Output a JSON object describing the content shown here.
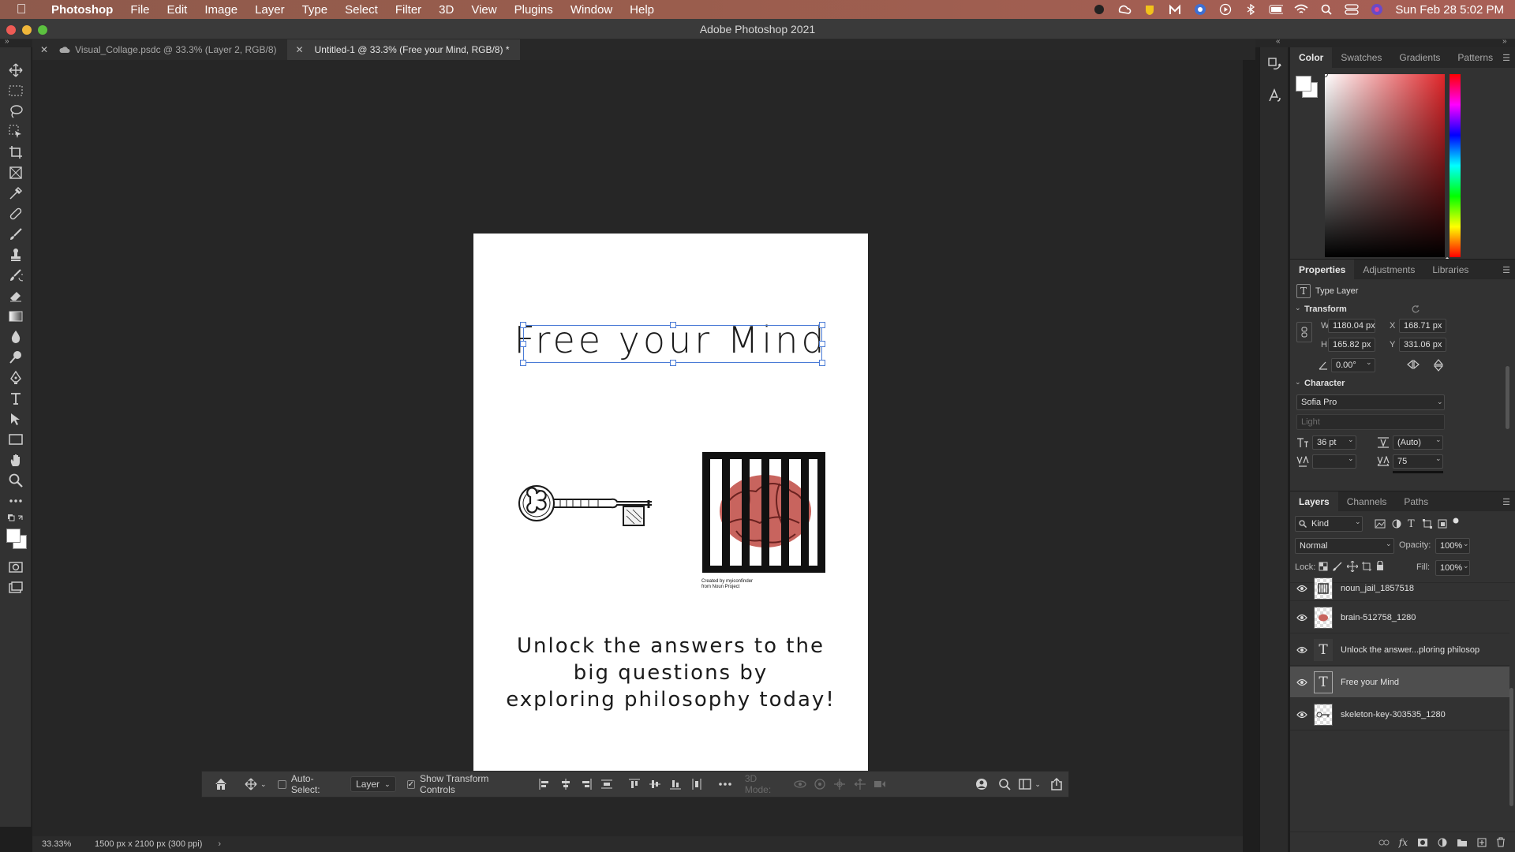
{
  "menubar": {
    "app": "Photoshop",
    "items": [
      "File",
      "Edit",
      "Image",
      "Layer",
      "Type",
      "Select",
      "Filter",
      "3D",
      "View",
      "Plugins",
      "Window",
      "Help"
    ],
    "clock": "Sun Feb 28  5:02 PM"
  },
  "window": {
    "title": "Adobe Photoshop 2021"
  },
  "doc_tabs": [
    {
      "label": "Visual_Collage.psdc @ 33.3% (Layer 2, RGB/8)",
      "active": false
    },
    {
      "label": "Untitled-1 @ 33.3% (Free your Mind, RGB/8) *",
      "active": true
    }
  ],
  "canvas": {
    "headline": "Free your Mind",
    "body_lines": [
      "Unlock the answers to the",
      "big questions by",
      "exploring philosophy today!"
    ],
    "credit_lines": [
      "Created by myiconfinder",
      "from Noun Project"
    ]
  },
  "options_bar": {
    "auto_select_label": "Auto-Select:",
    "auto_select_checked": false,
    "layer_dropdown": "Layer",
    "show_transform_label": "Show Transform Controls",
    "show_transform_checked": true,
    "mode_3d_label": "3D Mode:"
  },
  "status_bar": {
    "zoom": "33.33%",
    "doc_info": "1500 px x 2100 px (300 ppi)"
  },
  "color_panel": {
    "tabs": [
      "Color",
      "Swatches",
      "Gradients",
      "Patterns"
    ],
    "active_tab": "Color",
    "hue_color": "#e0262a"
  },
  "properties_panel": {
    "tabs": [
      "Properties",
      "Adjustments",
      "Libraries"
    ],
    "active_tab": "Properties",
    "layer_type": "Type Layer",
    "transform_title": "Transform",
    "w_label": "W",
    "w": "1180.04 px",
    "x_label": "X",
    "x": "168.71 px",
    "h_label": "H",
    "h": "165.82 px",
    "y_label": "Y",
    "y": "331.06 px",
    "angle": "0.00°",
    "character_title": "Character",
    "font_family": "Sofia Pro",
    "font_style": "Light",
    "font_size": "36 pt",
    "leading": "(Auto)",
    "kerning": "",
    "tracking": "75"
  },
  "layers_panel": {
    "tabs": [
      "Layers",
      "Channels",
      "Paths"
    ],
    "active_tab": "Layers",
    "filter": "Kind",
    "blend_mode": "Normal",
    "opacity_label": "Opacity:",
    "opacity": "100%",
    "lock_label": "Lock:",
    "fill_label": "Fill:",
    "fill": "100%",
    "layers": [
      {
        "name": "noun_jail_1857518",
        "kind": "smart",
        "selected": false
      },
      {
        "name": "brain-512758_1280",
        "kind": "smart",
        "selected": false
      },
      {
        "name": "Unlock the answer...ploring philosop",
        "kind": "type",
        "selected": false
      },
      {
        "name": "Free your Mind",
        "kind": "type",
        "selected": true
      },
      {
        "name": "skeleton-key-303535_1280",
        "kind": "smart",
        "selected": false
      }
    ]
  }
}
